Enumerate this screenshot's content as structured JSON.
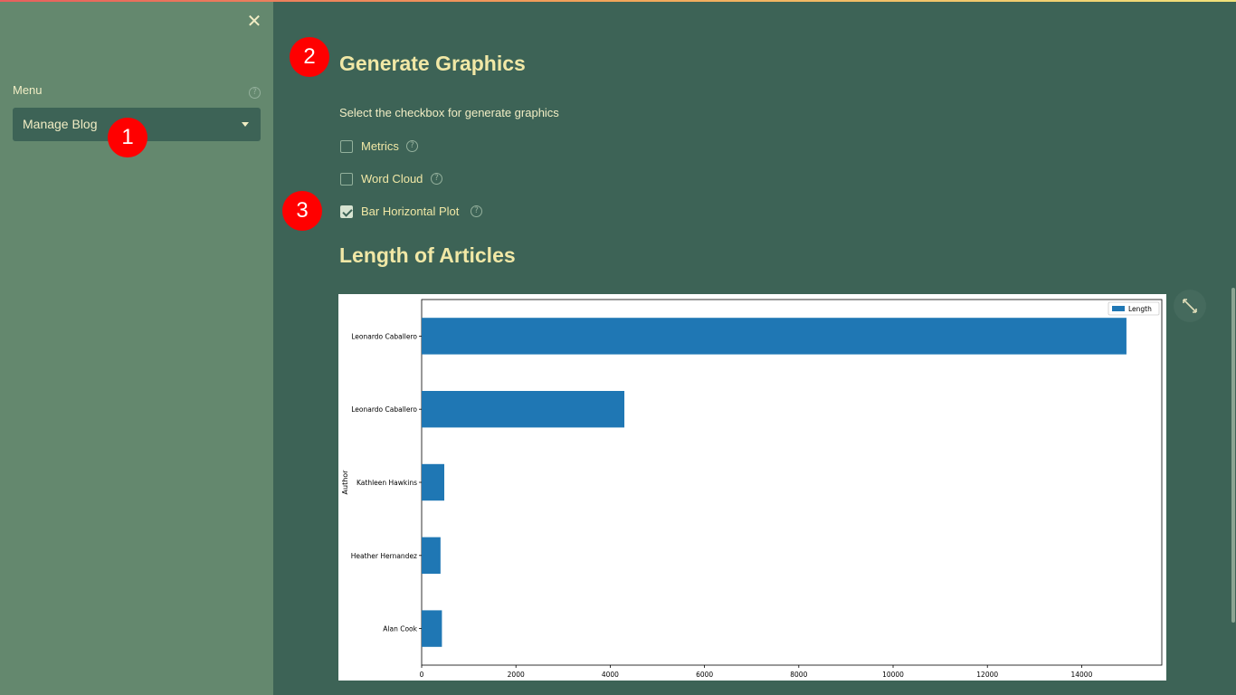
{
  "sidebar": {
    "close_symbol": "✕",
    "menu_label": "Menu",
    "help_symbol": "?",
    "select_value": "Manage Blog"
  },
  "markers": [
    "1",
    "2",
    "3"
  ],
  "main": {
    "title": "Generate Graphics",
    "instruction": "Select the checkbox for generate graphics",
    "checkboxes": [
      {
        "label": "Metrics",
        "checked": false
      },
      {
        "label": "Word Cloud",
        "checked": false
      },
      {
        "label": "Bar Horizontal Plot",
        "checked": true
      }
    ],
    "chart_title": "Length of Articles"
  },
  "colors": {
    "bar": "#1f77b4",
    "heading": "#f1e8a6",
    "sidebar_bg": "#64886e",
    "main_bg": "#3d6356",
    "marker": "#ff0000"
  },
  "chart_data": {
    "type": "bar",
    "orientation": "horizontal",
    "categories": [
      "Leonardo Caballero",
      "Leonardo Caballero",
      "Kathleen Hawkins",
      "Heather Hernandez",
      "Alan Cook"
    ],
    "series": [
      {
        "name": "Length",
        "values": [
          14950,
          4300,
          480,
          400,
          430
        ]
      }
    ],
    "ylabel": "Author",
    "xlim": [
      0,
      15700
    ],
    "xticks": [
      0,
      2000,
      4000,
      6000,
      8000,
      10000,
      12000,
      14000
    ],
    "legend": "top-right"
  }
}
